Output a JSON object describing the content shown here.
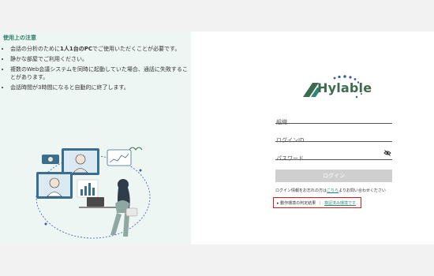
{
  "notes": {
    "title": "使用上の注意",
    "items": [
      {
        "pre": "会話の分析のために",
        "bold": "1人1台のPC",
        "post": "でご使用いただくことが必要です。"
      },
      {
        "pre": "静かな部屋でご利用ください。",
        "bold": "",
        "post": ""
      },
      {
        "pre": "複数のWeb会議システムを同時に起動していた場合、通話に失敗することがあります。",
        "bold": "",
        "post": ""
      },
      {
        "pre": "会話時間が3時間になると自動的に終了します。",
        "bold": "",
        "post": ""
      }
    ]
  },
  "logo": {
    "text": "Hylable"
  },
  "form": {
    "org_placeholder": "組織",
    "login_id_placeholder": "ログインID",
    "password_placeholder": "パスワード",
    "login_label": "ログイン",
    "help_pre": "ログイン情報をお忘れの方は",
    "help_link": "こちら",
    "help_post": "よりお問い合わせください",
    "check_label": "▸ 動作環境の判定結果",
    "check_separator": "|",
    "check_result": "検証済み環境です"
  },
  "colors": {
    "accent": "#2a8a7a",
    "highlight_border": "#e01818",
    "left_panel_bg": "#eef6f3",
    "button_disabled": "#cfcfcf"
  }
}
